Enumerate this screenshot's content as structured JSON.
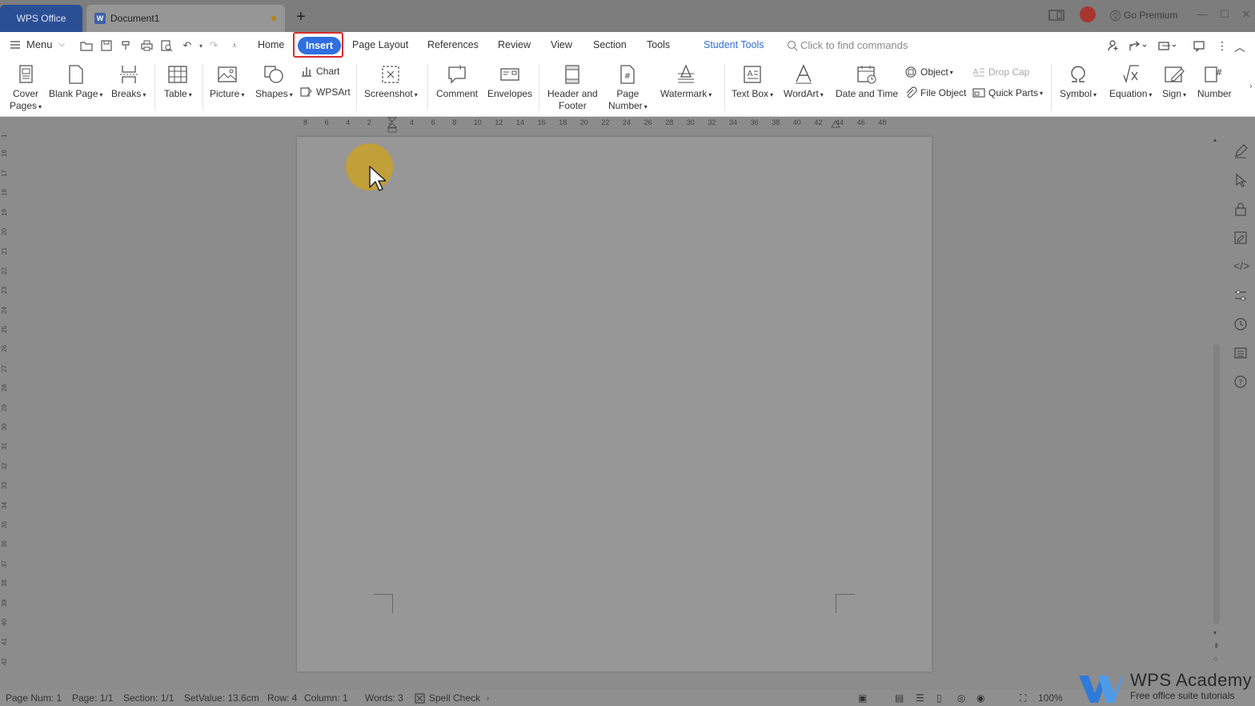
{
  "titlebar": {
    "app_tab": "WPS Office",
    "doc_tab": "Document1",
    "go_premium": "Go Premium"
  },
  "menubar": {
    "menu_label": "Menu",
    "tabs": [
      "Home",
      "Insert",
      "Page Layout",
      "References",
      "Review",
      "View",
      "Section",
      "Tools",
      "Student Tools"
    ],
    "active_tab": "Insert",
    "find_placeholder": "Click to find commands"
  },
  "ribbon": {
    "cover_pages": [
      "Cover",
      "Pages"
    ],
    "blank_page": "Blank Page",
    "breaks": "Breaks",
    "table": "Table",
    "picture": "Picture",
    "shapes": "Shapes",
    "chart": "Chart",
    "wpsart": "WPSArt",
    "screenshot": "Screenshot",
    "comment": "Comment",
    "envelopes": "Envelopes",
    "header_footer": [
      "Header and",
      "Footer"
    ],
    "page_number": [
      "Page",
      "Number"
    ],
    "watermark": "Watermark",
    "text_box": "Text Box",
    "wordart": "WordArt",
    "date_time": "Date and Time",
    "object": "Object",
    "file_object": "File Object",
    "drop_cap": "Drop Cap",
    "quick_parts": "Quick Parts",
    "symbol": "Symbol",
    "equation": "Equation",
    "sign": "Sign",
    "number": "Number"
  },
  "ruler": {
    "h_ticks": [
      "8",
      "6",
      "4",
      "2",
      "2",
      "4",
      "6",
      "8",
      "10",
      "12",
      "14",
      "16",
      "18",
      "20",
      "22",
      "24",
      "26",
      "28",
      "30",
      "32",
      "34",
      "36",
      "38",
      "40",
      "42",
      "44",
      "46",
      "48"
    ],
    "v_ticks": [
      "1",
      "16",
      "17",
      "18",
      "19",
      "20",
      "21",
      "22",
      "23",
      "24",
      "25",
      "26",
      "27",
      "28",
      "29",
      "30",
      "31",
      "32",
      "33",
      "34",
      "35",
      "36",
      "37",
      "38",
      "39",
      "40",
      "41",
      "42"
    ]
  },
  "status": {
    "page_num": "Page Num: 1",
    "page": "Page: 1/1",
    "section": "Section: 1/1",
    "setvalue": "SetValue: 13.6cm",
    "row": "Row: 4",
    "column": "Column: 1",
    "words": "Words: 3",
    "spell_check": "Spell Check",
    "zoom": "100%"
  },
  "watermark": {
    "title": "WPS Academy",
    "subtitle": "Free office suite tutorials"
  },
  "colors": {
    "accent": "#2f6fe0",
    "highlight_frame": "#d82c2c",
    "app_tab": "#2b4f95"
  }
}
